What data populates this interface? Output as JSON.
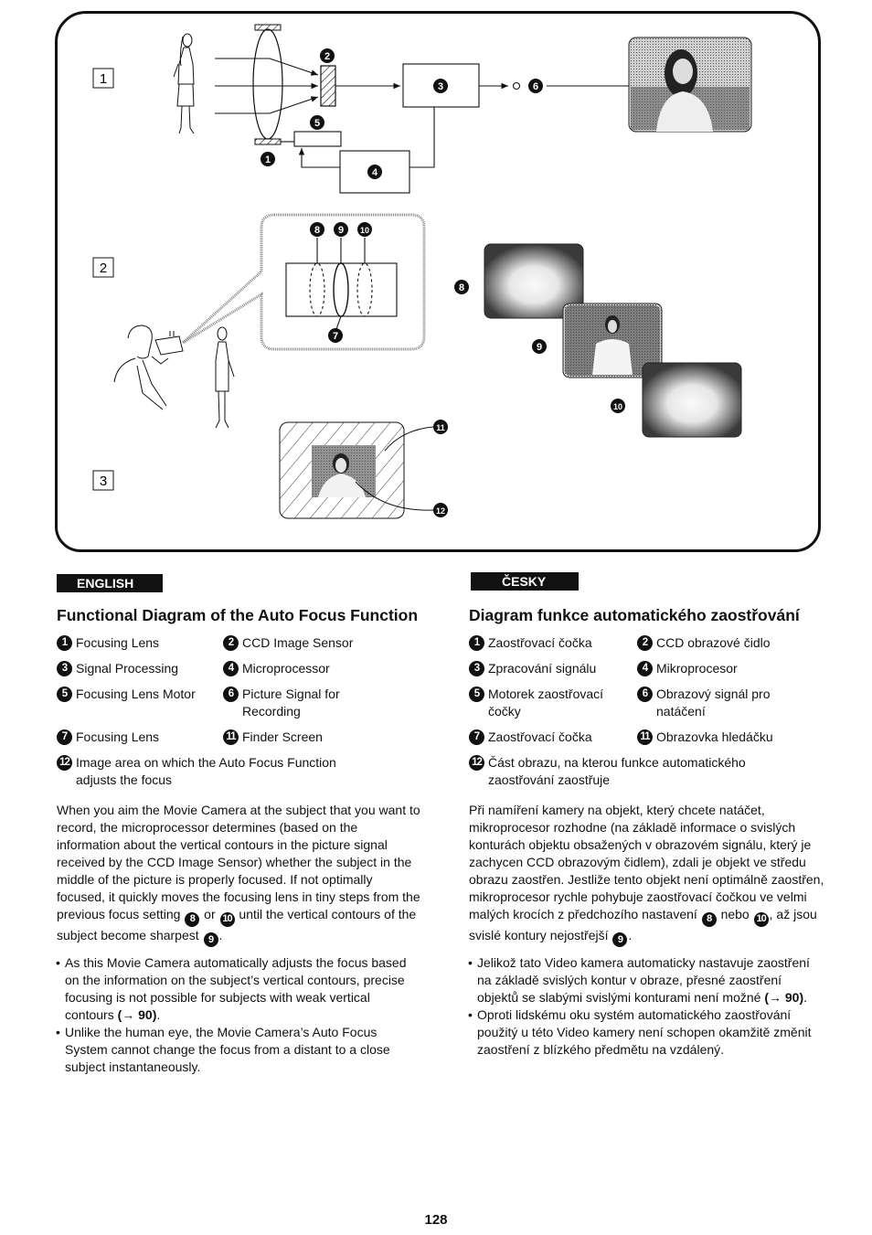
{
  "figure": {
    "panels": [
      {
        "label": "1"
      },
      {
        "label": "2"
      },
      {
        "label": "3"
      }
    ],
    "callouts": [
      "1",
      "2",
      "3",
      "4",
      "5",
      "6",
      "7",
      "8",
      "9",
      "10",
      "11",
      "12"
    ]
  },
  "english": {
    "tab": "ENGLISH",
    "heading": "Functional Diagram of the Auto Focus Function",
    "legend": [
      {
        "num": "1",
        "label": "Focusing Lens"
      },
      {
        "num": "2",
        "label": "CCD Image Sensor"
      },
      {
        "num": "3",
        "label": "Signal Processing"
      },
      {
        "num": "4",
        "label": "Microprocessor"
      },
      {
        "num": "5",
        "label": "Focusing Lens Motor"
      },
      {
        "num": "6",
        "label": "Picture Signal for Recording"
      },
      {
        "num": "7",
        "label": "Focusing Lens"
      },
      {
        "num": "11",
        "label": "Finder Screen"
      },
      {
        "num": "12",
        "label": "Image area on which the Auto Focus Function adjusts the focus"
      }
    ],
    "paragraph": {
      "part1": "When you aim the Movie Camera at the subject that you want to record, the microprocessor determines (based on the information about the vertical contours in the picture signal received by the CCD Image Sensor) whether the subject in the middle of the picture is properly focused. If not optimally focused, it quickly moves the focusing lens  in tiny steps from the previous focus setting ",
      "ref1": "8",
      "part2": " or ",
      "ref2": "10",
      "part3": " until the vertical contours of the subject become sharpest ",
      "ref3": "9",
      "part4": "."
    },
    "bullets": [
      {
        "text": "As this Movie Camera automatically adjusts the focus based on the information on the subject’s vertical contours, precise focusing is not possible for subjects with weak vertical contours ",
        "ref": "(→ 90)",
        "end": "."
      },
      {
        "text": "Unlike the human eye, the Movie Camera’s Auto Focus System cannot change the focus from a distant to a close subject instantaneously.",
        "ref": "",
        "end": ""
      }
    ]
  },
  "czech": {
    "tab": "ČESKY",
    "heading": "Diagram funkce automatického zaostřování",
    "legend": [
      {
        "num": "1",
        "label": "Zaostřovací čočka"
      },
      {
        "num": "2",
        "label": "CCD obrazové čidlo"
      },
      {
        "num": "3",
        "label": "Zpracování signálu"
      },
      {
        "num": "4",
        "label": "Mikroprocesor"
      },
      {
        "num": "5",
        "label": "Motorek zaostřovací čočky"
      },
      {
        "num": "6",
        "label": "Obrazový signál pro natáčení"
      },
      {
        "num": "7",
        "label": "Zaostřovací čočka"
      },
      {
        "num": "11",
        "label": "Obrazovka hledáčku"
      },
      {
        "num": "12",
        "label": "Část obrazu, na kterou funkce automatického zaostřování zaostřuje"
      }
    ],
    "paragraph": {
      "part1": "Při namíření kamery na objekt, který chcete natáčet, mikroprocesor rozhodne (na základě informace o svislých konturách objektu obsažených v obrazovém signálu, který je zachycen CCD obrazovým čidlem), zdali je objekt ve středu obrazu zaostřen. Jestliže tento objekt není optimálně zaostřen, mikroprocesor rychle pohybuje zaostřovací čočkou ve velmi malých krocích z předchozího nastavení ",
      "ref1": "8",
      "part2": " nebo ",
      "ref2": "10",
      "part3": ", až jsou svislé kontury nejostřejší ",
      "ref3": "9",
      "part4": "."
    },
    "bullets": [
      {
        "text": "Jelikož tato Video kamera automaticky nastavuje zaostření na základě svislých kontur v obraze, přesné zaostření objektů se slabými svislými konturami není možné ",
        "ref": "(→ 90)",
        "end": "."
      },
      {
        "text": "Oproti lidskému oku systém automatického zaostřování použitý u této Video kamery není schopen okamžitě změnit zaostření z blízkého předmětu na vzdálený.",
        "ref": "",
        "end": ""
      }
    ]
  },
  "page_number": "128"
}
